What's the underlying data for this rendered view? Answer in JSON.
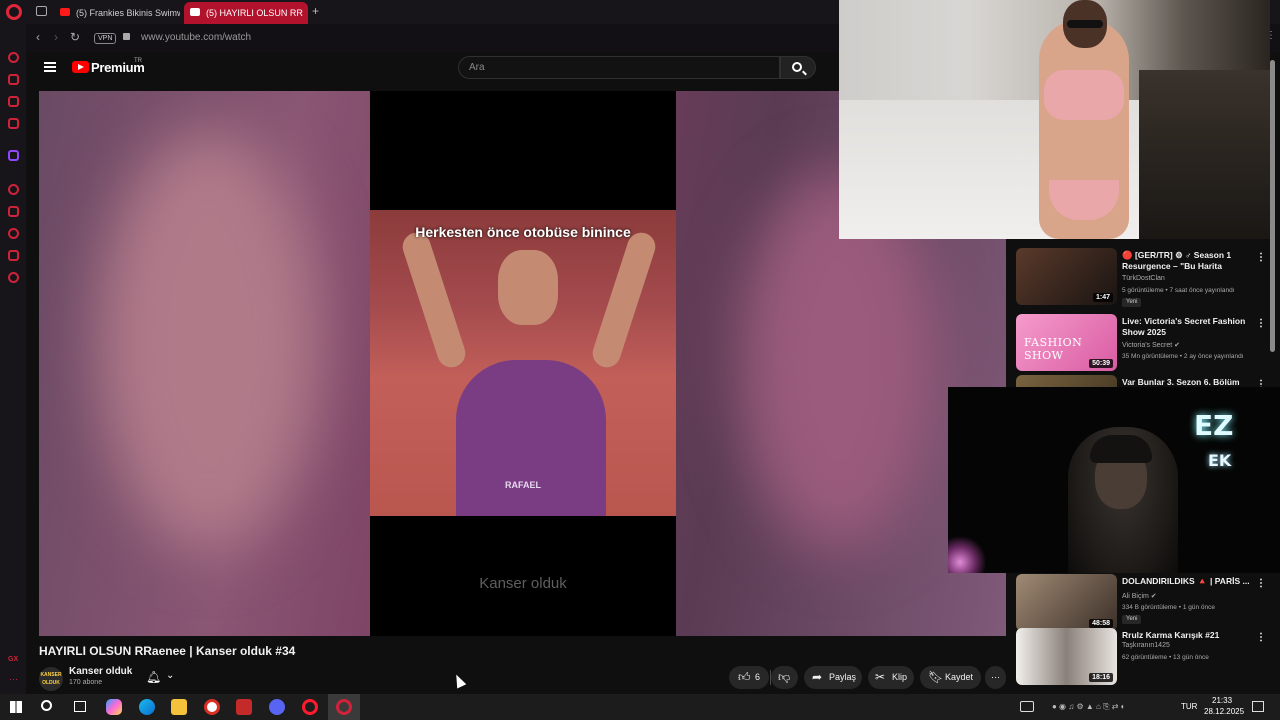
{
  "browser": {
    "tabs": [
      {
        "title": "(5) Frankies Bikinis Swimw",
        "active": false
      },
      {
        "title": "(5) HAYIRLI OLSUN RR",
        "active": true
      }
    ],
    "new_tab_label": "+",
    "vpn_label": "VPN",
    "url": "www.youtube.com/watch"
  },
  "yt_header": {
    "logo_text": "Premium",
    "logo_suffix": "TR",
    "search_placeholder": "Ara"
  },
  "player": {
    "clip_caption": "Herkesten önce otobüse binince",
    "shirt_text": "RAFAEL",
    "watermark": "Kanser olduk"
  },
  "video": {
    "title": "HAYIRLI OLSUN RRaenee | Kanser olduk #34",
    "channel_name": "Kanser olduk",
    "channel_avatar_text": "KANSER OLDUK",
    "subscribers": "170 abone",
    "like_count": "6",
    "share_label": "Paylaş",
    "clip_label": "Klip",
    "save_label": "Kaydet",
    "more_label": "⋯"
  },
  "recommendations": [
    {
      "title": "🔴 [GER/TR] ⚙ ♂ Season 1 Resurgence – \"Bu Harita Farklı...",
      "channel": "TürkDostClan",
      "meta": "5 görüntüleme • 7 saat önce yayınlandı",
      "badge": "Yeni",
      "duration": "1:47",
      "thumb_color": "#3b2a22"
    },
    {
      "title": "Live: Victoria's Secret Fashion Show 2025",
      "channel": "Victoria's Secret ✔",
      "meta": "35 Mn görüntüleme • 2 ay önce yayınlandı",
      "badge": "",
      "duration": "50:39",
      "thumb_color": "#e377b4",
      "thumb_text": "FASHION SHOW"
    },
    {
      "title": "Var Bunlar 3. Sezon 6. Bölüm",
      "channel": "",
      "meta": "",
      "badge": "",
      "duration": "",
      "thumb_color": "#5a4a30"
    },
    {
      "title": "DOLANDIRILDIKS 🔺 | PARİS ...",
      "channel": "Ali Biçim ✔",
      "meta": "334 B görüntüleme • 1 gün önce",
      "badge": "Yeni",
      "duration": "48:58",
      "thumb_color": "#6a5a4c"
    },
    {
      "title": "Rrulz Karma Karışık #21",
      "channel": "Taşkıranın1425",
      "meta": "62 görüntüleme • 13 gün önce",
      "badge": "",
      "duration": "18:16",
      "thumb_color": "#c9c3bd"
    }
  ],
  "cam_overlay": {
    "logo": "EZ",
    "sub": "EK"
  },
  "taskbar": {
    "language": "TUR",
    "time": "21:33",
    "date": "28.12.2025"
  }
}
